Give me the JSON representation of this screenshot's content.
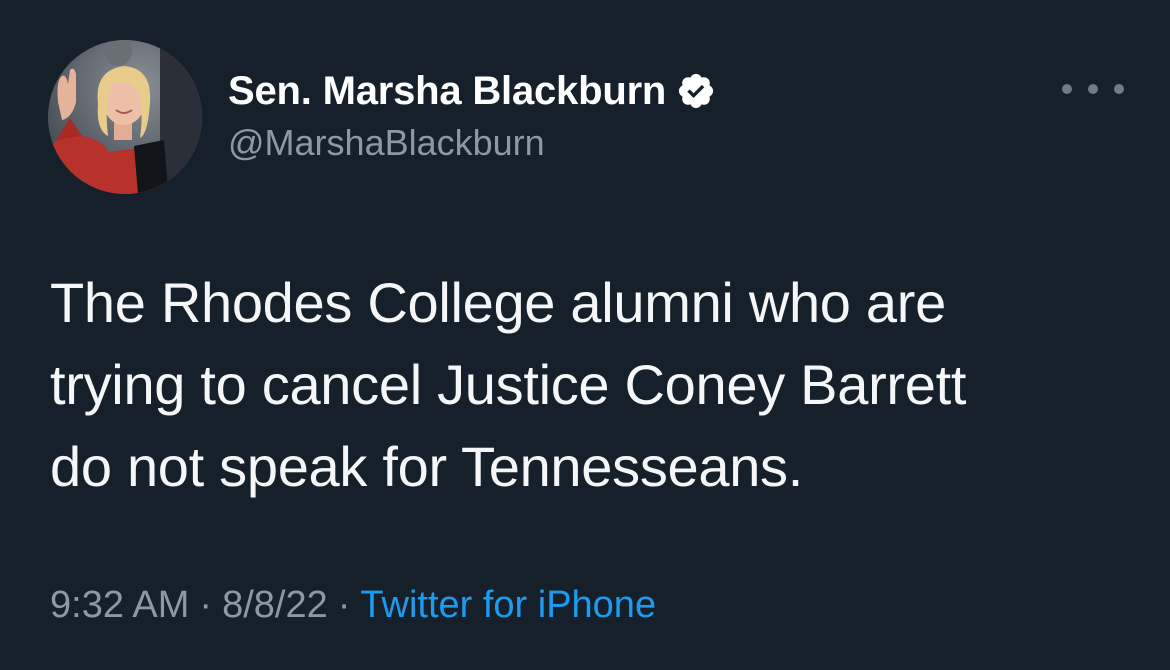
{
  "author": {
    "display_name": "Sen. Marsha Blackburn",
    "handle": "@MarshaBlackburn",
    "verified": true
  },
  "tweet": {
    "text_lines": [
      "The Rhodes College alumni who are",
      "trying to cancel Justice Coney Barrett",
      "do not speak for Tennesseans."
    ]
  },
  "meta": {
    "time": "9:32 AM",
    "separator": "·",
    "date": "8/8/22",
    "source": "Twitter for iPhone"
  },
  "icons": {
    "verified": "verified-badge-icon",
    "more": "more-options-icon"
  },
  "colors": {
    "background": "#15202b",
    "text": "#ffffff",
    "secondary_text": "#8b98a5",
    "link": "#1d9bf0"
  }
}
